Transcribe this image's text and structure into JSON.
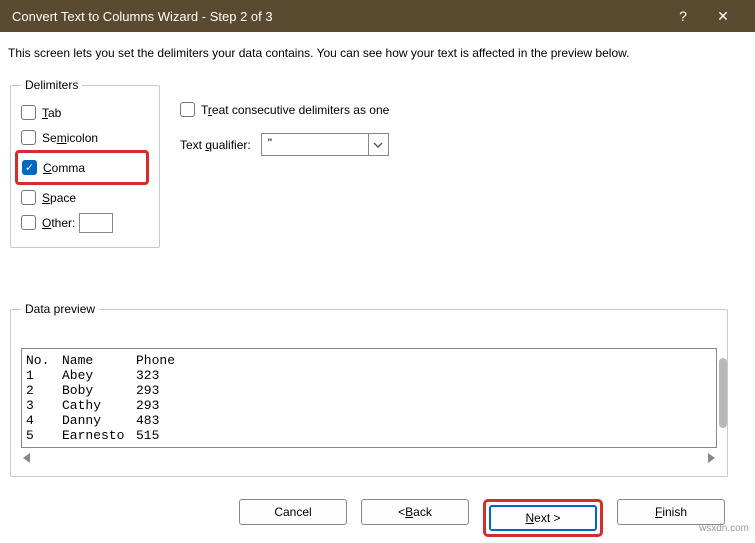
{
  "titlebar": {
    "title": "Convert Text to Columns Wizard - Step 2 of 3",
    "help": "?",
    "close": "✕"
  },
  "description": "This screen lets you set the delimiters your data contains.  You can see how your text is affected in the preview below.",
  "delimiters": {
    "legend": "Delimiters",
    "tab": "Tab",
    "semicolon": "Semicolon",
    "comma": "Comma",
    "space": "Space",
    "other": "Other:"
  },
  "options": {
    "treat": "Treat consecutive delimiters as one",
    "qualifier_label": "Text qualifier:",
    "qualifier_value": "\""
  },
  "preview": {
    "legend": "Data preview",
    "headers": {
      "c0": "No.",
      "c1": "Name",
      "c2": "Phone"
    },
    "rows": [
      {
        "c0": "1",
        "c1": "Abey",
        "c2": "323"
      },
      {
        "c0": "2",
        "c1": "Boby",
        "c2": "293"
      },
      {
        "c0": "3",
        "c1": "Cathy",
        "c2": "293"
      },
      {
        "c0": "4",
        "c1": "Danny",
        "c2": "483"
      },
      {
        "c0": "5",
        "c1": "Earnesto",
        "c2": "515"
      }
    ]
  },
  "footer": {
    "cancel": "Cancel",
    "back": "< Back",
    "next": "Next >",
    "finish": "Finish"
  },
  "watermark": "wsxdn.com"
}
